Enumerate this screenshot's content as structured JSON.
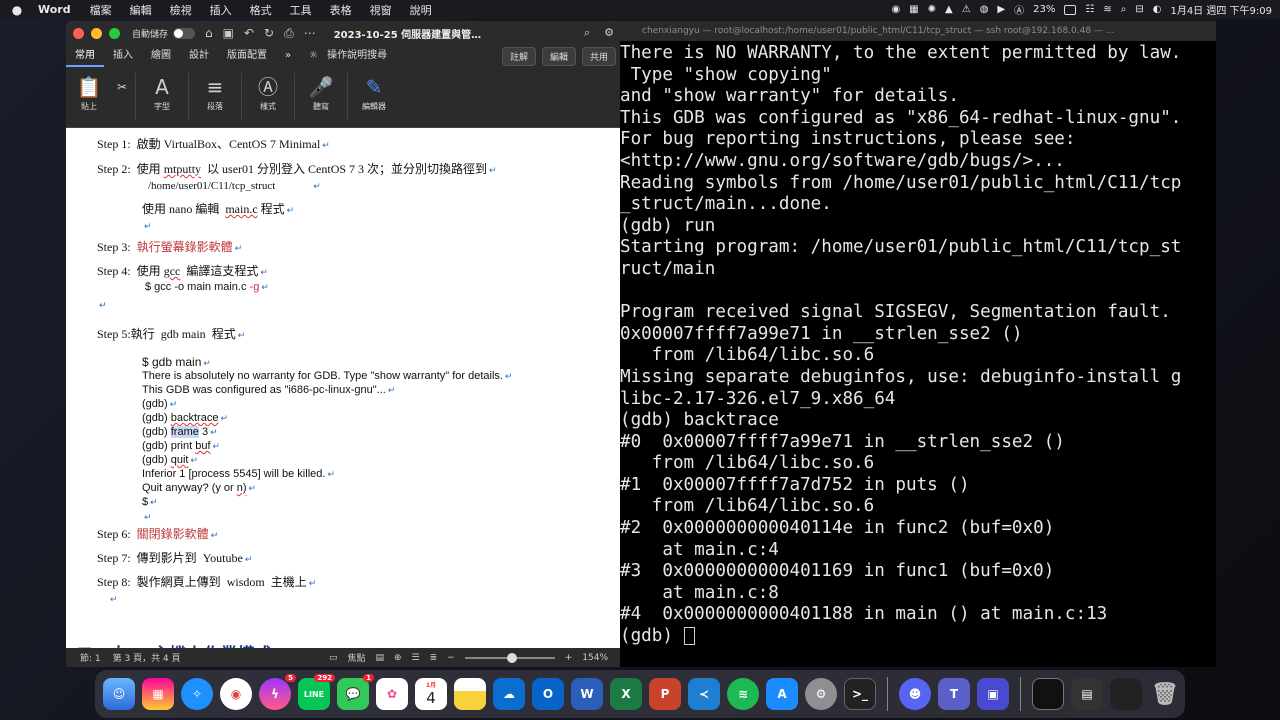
{
  "menubar": {
    "app_name": "Word",
    "menus": [
      "檔案",
      "編輯",
      "檢視",
      "插入",
      "格式",
      "工具",
      "表格",
      "視窗",
      "說明"
    ],
    "battery": "23%",
    "clock": "1月4日 週四 下午9:09"
  },
  "word": {
    "autosave_label": "自動儲存",
    "doc_title": "2023-10-25 伺服器建置與管…",
    "tabs": [
      "常用",
      "插入",
      "繪圖",
      "設計",
      "版面配置"
    ],
    "tell_me": "操作說明搜尋",
    "comment_btn": "註解",
    "edit_btn": "編輯",
    "share_btn": "共用",
    "ribbon": {
      "paste": "貼上",
      "font": "字型",
      "paragraph": "段落",
      "styles": "樣式",
      "dictate": "聽寫",
      "editor": "編輯器"
    },
    "doc": {
      "step1_label": "Step 1:",
      "step1_text": "啟動 VirtualBox、CentOS 7 Minimal",
      "step2_label": "Step 2:",
      "step2_a": "使用",
      "step2_b": "mtputty",
      "step2_c": "以 user01 分別登入 CentOS 7 3 次；並分別切換路徑到",
      "step2_path": "/home/user01/C11/tcp_struct",
      "step2_nano_a": "使用 nano 編輯",
      "step2_nano_b": "main.c",
      "step2_nano_c": "程式",
      "step3_label": "Step 3:",
      "step3_text": "執行螢幕錄影軟體",
      "step4_label": "Step 4:",
      "step4_a": "使用",
      "step4_b": "gcc",
      "step4_c": "編譯這支程式",
      "step4_cmd_a": "$ gcc -o main main.c",
      "step4_cmd_b": "-g",
      "step5_label": "Step 5:",
      "step5_a": "執行",
      "step5_b": "gdb main",
      "step5_c": "程式",
      "gdb_main": "$ gdb main",
      "gdb_l1": "There is absolutely no warranty for GDB.  Type \"show warranty\" for details.",
      "gdb_l2": "This GDB was configured as \"i686-pc-linux-gnu\"...",
      "gdb_l3": "(gdb)",
      "gdb_l4a": "(gdb)",
      "gdb_l4b": "backtrace",
      "gdb_l5a": "(gdb)",
      "gdb_l5b": "frame",
      "gdb_l5c": "3",
      "gdb_l6a": "(gdb) print",
      "gdb_l6b": "buf",
      "gdb_l7a": "(gdb)",
      "gdb_l7b": "quit",
      "gdb_l8": "Inferior 1 [process 5545] will be killed.",
      "gdb_l9a": "Quit anyway? (y or",
      "gdb_l9b": "n)",
      "gdb_l10": "$",
      "step6_label": "Step 6:",
      "step6_text": "關閉錄影軟體",
      "step7_label": "Step 7:",
      "step7_a": "傳到影片到",
      "step7_b": "Youtube",
      "step8_label": "Step 8:",
      "step8_a": "製作網頁上傳到",
      "step8_b": "wisdom",
      "step8_c": "主機上",
      "heading": "二．十 、 主機上作業模式"
    },
    "status": {
      "section": "節: 1",
      "page": "第 3 頁，共 4 頁",
      "focus": "焦點",
      "zoom": "154%",
      "zoom_fraction": 0.52
    }
  },
  "terminal": {
    "title": "chenxiangyu — root@localhost:/home/user01/public_html/C11/tcp_struct — ssh root@192.168.0.48 — ...",
    "lines": [
      "There is NO WARRANTY, to the extent permitted by law.",
      " Type \"show copying\"",
      "and \"show warranty\" for details.",
      "This GDB was configured as \"x86_64-redhat-linux-gnu\".",
      "For bug reporting instructions, please see:",
      "<http://www.gnu.org/software/gdb/bugs/>...",
      "Reading symbols from /home/user01/public_html/C11/tcp",
      "_struct/main...done.",
      "(gdb) run",
      "Starting program: /home/user01/public_html/C11/tcp_st",
      "ruct/main",
      "",
      "Program received signal SIGSEGV, Segmentation fault.",
      "0x00007ffff7a99e71 in __strlen_sse2 ()",
      "   from /lib64/libc.so.6",
      "Missing separate debuginfos, use: debuginfo-install g",
      "libc-2.17-326.el7_9.x86_64",
      "(gdb) backtrace",
      "#0  0x00007ffff7a99e71 in __strlen_sse2 ()",
      "   from /lib64/libc.so.6",
      "#1  0x00007ffff7a7d752 in puts ()",
      "   from /lib64/libc.so.6",
      "#2  0x000000000040114e in func2 (buf=0x0)",
      "    at main.c:4",
      "#3  0x0000000000401169 in func1 (buf=0x0)",
      "    at main.c:8",
      "#4  0x0000000000401188 in main () at main.c:13"
    ],
    "prompt": "(gdb) "
  },
  "dock": {
    "messenger_badge": "5",
    "line_badge": "292",
    "messages_badge": "1",
    "calendar_month": "1月",
    "calendar_day": "4"
  }
}
